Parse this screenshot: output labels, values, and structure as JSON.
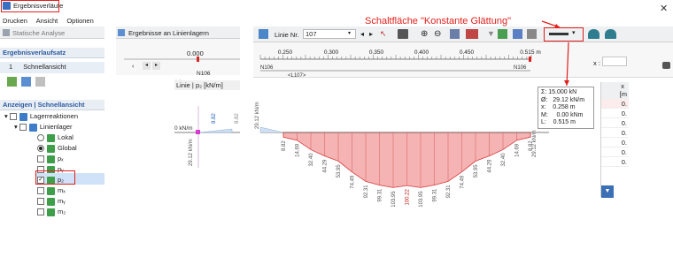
{
  "colors": {
    "accent_red": "#e0201c",
    "diagram_fill": "#f6b3b3",
    "diagram_stroke": "#d63a3a",
    "blue_text": "#1f5fbf"
  },
  "window": {
    "title": "Ergebnisverläufe"
  },
  "menu": [
    "Drucken",
    "Ansicht",
    "Optionen"
  ],
  "toolbar_left": {
    "statische_analyse": "Statische Analyse"
  },
  "toolbar_mid": {
    "ergebnisse_label": "Ergebnisse an Linienlagern"
  },
  "toolbar_right": {
    "linie_nr_label": "Linie Nr.",
    "linie_nr_value": "107"
  },
  "callout": {
    "text": "Schaltfläche \"Konstante Glättung\""
  },
  "left_panel": {
    "header1": "Ergebnisverlaufsatz",
    "set_row": {
      "number": "1",
      "label": "Schnellansicht"
    },
    "header2": "Anzeigen | Schnellansicht",
    "tree": {
      "lagerreaktionen": "Lagerreaktionen",
      "linienlager": "Linienlager",
      "lokal": "Lokal",
      "global": "Global",
      "px": "pₓ",
      "py": "pᵧ",
      "pz": "p₂",
      "mx": "mₓ",
      "my": "mᵧ",
      "mz": "m₂"
    }
  },
  "middle_panel": {
    "row_label": "Linie | p₂ [kN/m]",
    "x_tick": "0.000",
    "node": "N106",
    "zero_label": "0 kN/m",
    "left_vertical": "29.12 kN/m",
    "value_882": "8.82"
  },
  "ruler": {
    "ticks": [
      "0.250",
      "0.300",
      "0.350",
      "0.400",
      "0.450",
      "0.515 m"
    ],
    "node_left": "N106",
    "node_right": "N106",
    "member": "<L107>",
    "x_label": "x :"
  },
  "info": {
    "rows": [
      {
        "sym": "Σ:",
        "value": "15.000",
        "unit": "kN"
      },
      {
        "sym": "Ø:",
        "value": "29.12",
        "unit": "kN/m"
      },
      {
        "sym": "x:",
        "value": "0.258",
        "unit": "m"
      },
      {
        "sym": "M:",
        "value": "0.00",
        "unit": "kNm"
      },
      {
        "sym": "L:",
        "value": "0.515",
        "unit": "m"
      }
    ]
  },
  "table": {
    "col_header": "x",
    "unit_header": "[m",
    "cells": [
      "0.",
      "0.",
      "0.",
      "0.",
      "0.",
      "0.",
      "0."
    ]
  },
  "chart_data": {
    "type": "area",
    "title": "",
    "xlabel": "",
    "ylabel": "",
    "value_labels": [
      "8.82",
      "14.69",
      "32.40",
      "44.29",
      "53.95",
      "74.49",
      "92.31",
      "99.31",
      "103.95",
      "100.22",
      "103.95",
      "99.31",
      "92.31",
      "74.49",
      "53.95",
      "44.29",
      "32.40",
      "14.69",
      "8.82"
    ],
    "end_label_left": "29.12 kN/m",
    "end_label_right": "29.12 kN/m",
    "max_label": "100.22"
  }
}
